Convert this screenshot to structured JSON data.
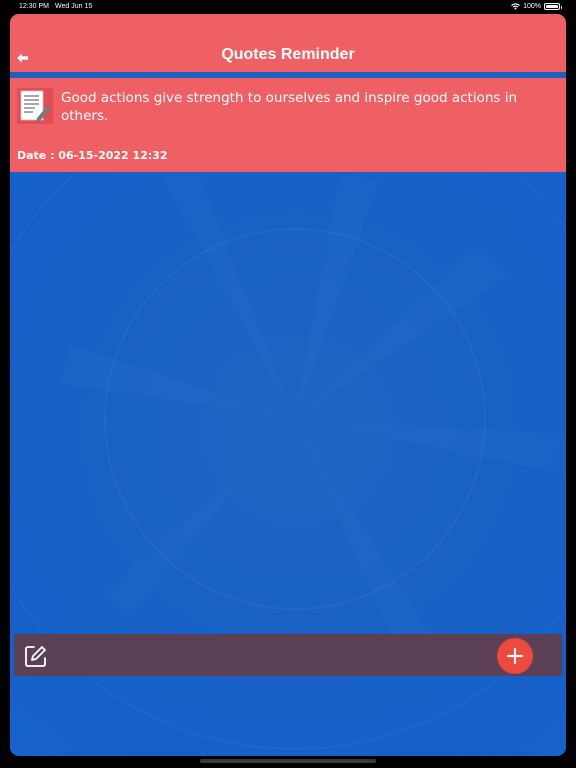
{
  "status_bar": {
    "time": "12:30 PM",
    "date": "Wed Jun 15",
    "battery": "100%"
  },
  "nav": {
    "title": "Quotes Reminder",
    "back_icon": "back-arrow-icon"
  },
  "quote": {
    "icon": "note-icon",
    "text": "Good actions give strength to ourselves and inspire good actions in others.",
    "date": "Date : 06-15-2022 12:32"
  },
  "bottom_bar": {
    "edit_icon": "edit-icon",
    "add_icon": "plus-icon"
  },
  "colors": {
    "header": "#ef6064",
    "background": "#1961c3",
    "bottom_bar": "#5b4056",
    "add_button": "#ec4a3c"
  }
}
